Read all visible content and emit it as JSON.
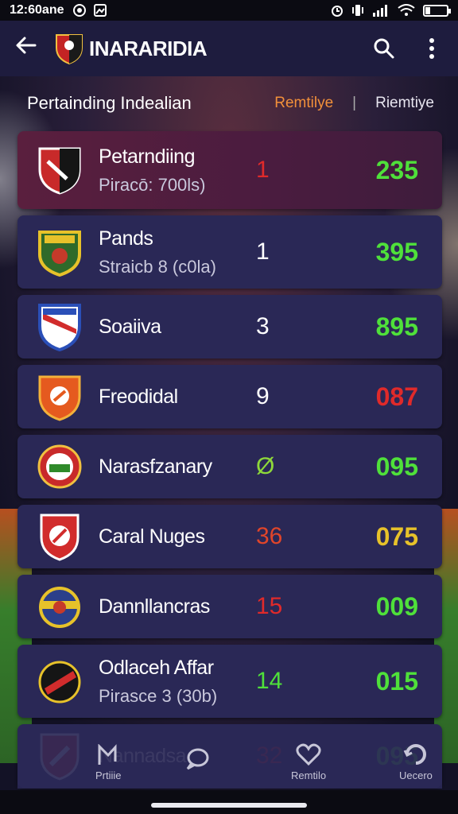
{
  "status": {
    "time": "12:60ane"
  },
  "appbar": {
    "title": "INARARIDIA"
  },
  "subheader": {
    "title": "Pertainding Indealian",
    "col1": "Remtilye",
    "col2": "Riemtiye"
  },
  "colors": {
    "red": "#e02a2a",
    "green": "#4fe03a",
    "yellow": "#e7c22a",
    "orange": "#f2903a"
  },
  "rows": [
    {
      "name": "Petarndiing",
      "sub": "Piracō: 700ls)",
      "rank": "1",
      "rank_color": "#e02a2a",
      "points": "235",
      "points_color": "#4fe03a",
      "badge": "red-black-shield-icon"
    },
    {
      "name": "Pands",
      "sub": "Straicb 8 (c0la)",
      "rank": "1",
      "rank_color": "#ffffff",
      "points": "395",
      "points_color": "#4fe03a",
      "badge": "green-gold-crest-icon"
    },
    {
      "name": "Soaiiva",
      "sub": "",
      "rank": "3",
      "rank_color": "#ffffff",
      "points": "895",
      "points_color": "#4fe03a",
      "badge": "blue-red-shield-icon"
    },
    {
      "name": "Freodidal",
      "sub": "",
      "rank": "9",
      "rank_color": "#ffffff",
      "points": "087",
      "points_color": "#e02a2a",
      "badge": "orange-shield-icon"
    },
    {
      "name": "Narasfzanary",
      "sub": "",
      "rank": "Ø",
      "rank_color": "#8ed83a",
      "points": "095",
      "points_color": "#4fe03a",
      "badge": "red-green-round-crest-icon"
    },
    {
      "name": "Caral Nuges",
      "sub": "",
      "rank": "36",
      "rank_color": "#e0452a",
      "points": "075",
      "points_color": "#e7c22a",
      "badge": "red-white-shield-icon"
    },
    {
      "name": "Dannllancras",
      "sub": "",
      "rank": "15",
      "rank_color": "#e02a2a",
      "points": "009",
      "points_color": "#4fe03a",
      "badge": "blue-gold-round-crest-icon"
    },
    {
      "name": "Odlaceh Affar",
      "sub": "Pirasce 3 (30b)",
      "rank": "14",
      "rank_color": "#4fe03a",
      "points": "015",
      "points_color": "#4fe03a",
      "badge": "black-red-round-crest-icon"
    },
    {
      "name": "Nannadsa",
      "sub": "",
      "rank": "32",
      "rank_color": "#e02a2a",
      "points": "095",
      "points_color": "#4fe03a",
      "badge": "red-shield-icon"
    }
  ],
  "nav": [
    {
      "label": "Prtiiie",
      "icon": "flag-icon"
    },
    {
      "label": "",
      "icon": "chat-bubble-icon"
    },
    {
      "label": "Remtilo",
      "icon": "heart-icon"
    },
    {
      "label": "Uecero",
      "icon": "refresh-icon"
    }
  ]
}
